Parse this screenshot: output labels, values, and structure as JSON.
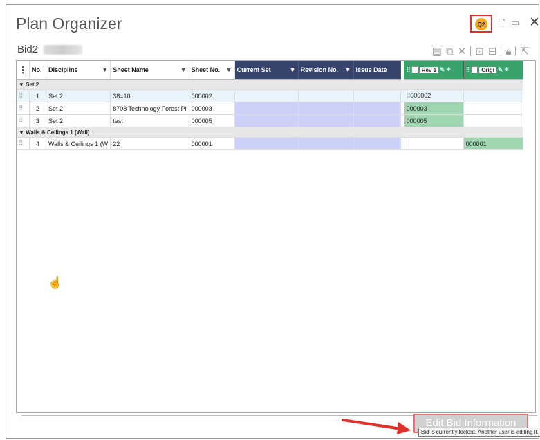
{
  "app": {
    "title": "Plan Organizer",
    "bid_name": "Bid2",
    "user_initials": "Q2"
  },
  "window": {
    "restore_glyph": "🗋",
    "max_glyph": "▭",
    "close_glyph": "✕"
  },
  "grid": {
    "columns": [
      "No.",
      "Discipline",
      "Sheet Name",
      "Sheet No.",
      "Current Set",
      "Revision No.",
      "Issue Date"
    ],
    "rev_labels": [
      "Rev 1",
      "Origi"
    ],
    "groups": [
      {
        "label": "Set 2",
        "rows": [
          {
            "no": "1",
            "discipline": "Set 2",
            "sheet_name": "38=10",
            "sheet_no": "000002",
            "rev1": "000002",
            "orig": "",
            "selected": true
          },
          {
            "no": "2",
            "discipline": "Set 2",
            "sheet_name": "8708 Technology Forest Pl",
            "sheet_no": "000003",
            "rev1": "000003",
            "orig": "",
            "selected": false
          },
          {
            "no": "3",
            "discipline": "Set 2",
            "sheet_name": "test",
            "sheet_no": "000005",
            "rev1": "000005",
            "orig": "",
            "selected": false
          }
        ]
      },
      {
        "label": "Walls & Ceilings 1 (Wall)",
        "rows": [
          {
            "no": "4",
            "discipline": "Walls & Ceilings 1 (W",
            "sheet_name": "22",
            "sheet_no": "000001",
            "rev1": "",
            "orig": "000001",
            "selected": false
          }
        ]
      }
    ]
  },
  "footer": {
    "edit_button": "Edit Bid Information",
    "tooltip": "Bid is currently locked. Another user is editing it."
  },
  "colors": {
    "header_dark": "#36436b",
    "lavender": "#cdd1f7",
    "green": "#9fd6b1",
    "highlight_red": "#e0302a"
  }
}
